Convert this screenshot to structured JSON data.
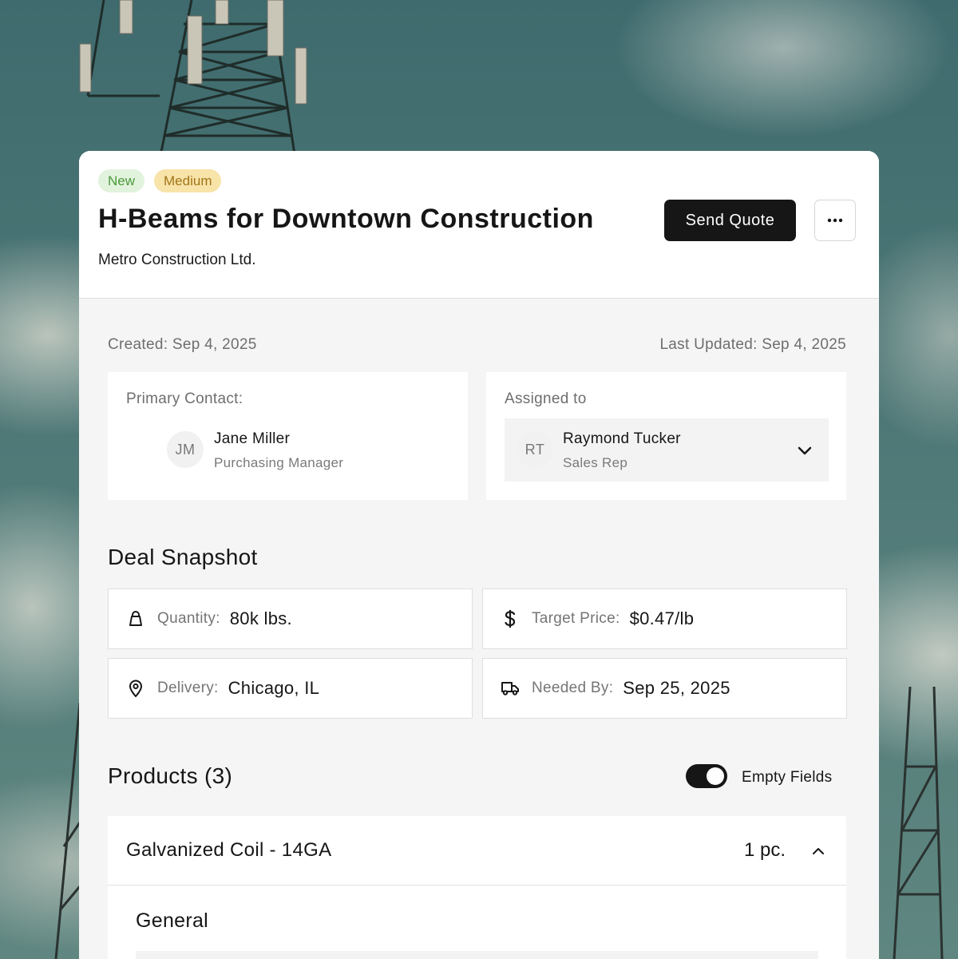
{
  "badges": {
    "status": "New",
    "priority": "Medium"
  },
  "header": {
    "title": "H-Beams for Downtown Construction",
    "company": "Metro Construction Ltd.",
    "send_quote": "Send Quote",
    "more": "···"
  },
  "dates": {
    "created": "Created: Sep 4, 2025",
    "updated": "Last Updated: Sep 4, 2025"
  },
  "primary_contact": {
    "label": "Primary Contact:",
    "initials": "JM",
    "name": "Jane Miller",
    "role": "Purchasing Manager"
  },
  "assigned": {
    "label": "Assigned to",
    "initials": "RT",
    "name": "Raymond Tucker",
    "role": "Sales Rep"
  },
  "snapshot": {
    "title": "Deal Snapshot",
    "quantity": {
      "label": "Quantity:",
      "value": "80k lbs.",
      "icon": "bag-icon"
    },
    "target_price": {
      "label": "Target Price:",
      "value": "$0.47/lb",
      "icon": "dollar-icon"
    },
    "delivery": {
      "label": "Delivery:",
      "value": "Chicago, IL",
      "icon": "location-pin-icon"
    },
    "needed_by": {
      "label": "Needed By:",
      "value": "Sep 25, 2025",
      "icon": "truck-icon"
    }
  },
  "products": {
    "title": "Products (3)",
    "toggle_label": "Empty Fields",
    "toggle_on": true,
    "items": [
      {
        "name": "Galvanized Coil - 14GA",
        "qty": "1 pc."
      }
    ],
    "section_general": "General"
  },
  "colors": {
    "badge_new_bg": "#e2f3dd",
    "badge_new_text": "#4a9a3a",
    "badge_medium_bg": "#f8e3a9",
    "badge_medium_text": "#a27618",
    "primary_button": "#161616"
  }
}
